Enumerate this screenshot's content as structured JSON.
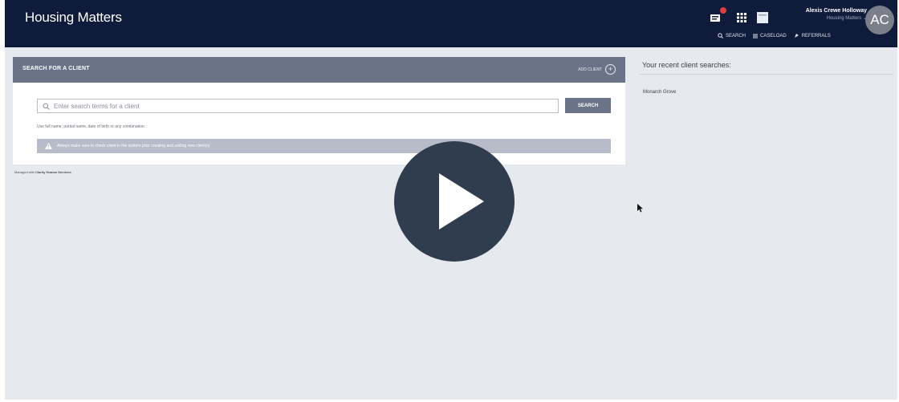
{
  "header": {
    "app_title": "Housing Matters",
    "user_name": "Alexis Crewe Holloway",
    "user_org": "Housing Matters ⌄",
    "avatar_initials": "AC",
    "nav": {
      "search": "SEARCH",
      "caseload": "CASELOAD",
      "referrals": "REFERRALS"
    },
    "icons": [
      "messages-icon",
      "apps-grid-icon",
      "window-icon"
    ]
  },
  "search_panel": {
    "title": "SEARCH FOR A CLIENT",
    "add_client": "ADD CLIENT",
    "input_placeholder": "Enter search terms for a client",
    "search_button": "SEARCH",
    "help_text": "Use full name, partial name, date of birth or any combination.",
    "warning": "Always make sure to check client in the system prior creating and adding new client(s)"
  },
  "footer": {
    "managed_prefix": "Managed with",
    "managed_by": "Clarity Human Services"
  },
  "recent": {
    "title": "Your recent client searches:",
    "items": [
      "Monarch Grove"
    ]
  },
  "colors": {
    "header_bg": "#0f1b3a",
    "panel_header_bg": "#6a7388",
    "page_bg": "#e6e9ee",
    "warning_bg": "#b8bcc8",
    "play_button": "#2f3d4f",
    "badge": "#e23b3b"
  }
}
